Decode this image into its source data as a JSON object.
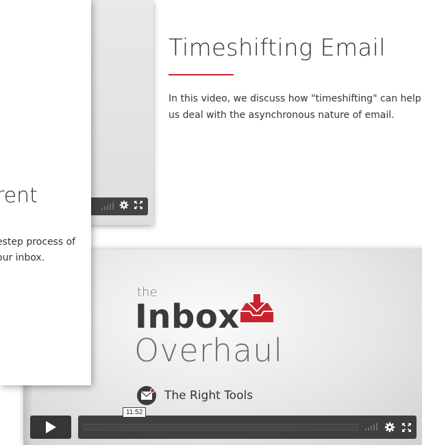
{
  "left_card": {
    "title": "rent",
    "desc_line1": "estep process of",
    "desc_line2": "our inbox."
  },
  "right_info": {
    "title": "Timeshifting Email",
    "description": "In this video, we discuss how \"timeshifting\" can help us deal with the asynchronous nature of email."
  },
  "player": {
    "logo_the": "the",
    "logo_inbox": "Inbox",
    "logo_overhaul": "Overhaul",
    "subtitle": "The Right Tools",
    "timecode": "11:52"
  },
  "colors": {
    "accent": "#c8232c",
    "controls": "#232323"
  },
  "icons": [
    "volume-icon",
    "gear-icon",
    "fullscreen-icon",
    "play-icon",
    "inbox-tray-icon",
    "envelope-icon"
  ]
}
